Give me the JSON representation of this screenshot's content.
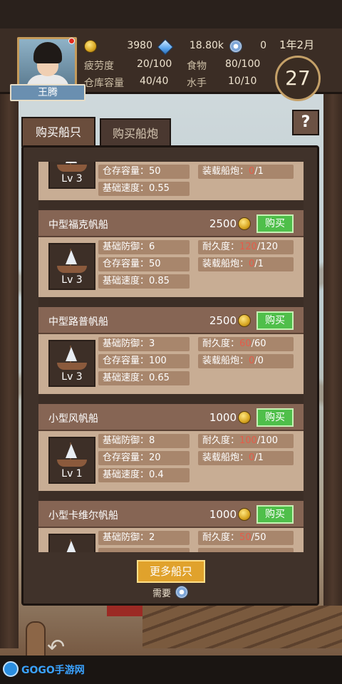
{
  "player": {
    "name": "王腾",
    "level": "27",
    "date": "1年2月"
  },
  "resources": {
    "gold": "3980",
    "gems": "18.80k",
    "medals": "0"
  },
  "stats": [
    {
      "label": "疲劳度",
      "value": "20/100"
    },
    {
      "label": "食物",
      "value": "80/100"
    },
    {
      "label": "仓库容量",
      "value": "40/40"
    },
    {
      "label": "水手",
      "value": "10/10"
    }
  ],
  "tabs": {
    "buy_ship": "购买船只",
    "buy_cannon": "购买船炮"
  },
  "help": "?",
  "partial_top": {
    "level": "Lv 3",
    "capacity": "仓存容量：50",
    "cannon_label": "装载船炮：",
    "cannon_cur": "0",
    "cannon_max": "/1",
    "speed": "基础速度：0.55"
  },
  "ships": [
    {
      "name": "中型福克帆船",
      "price": "2500",
      "buy": "购买",
      "level": "Lv 3",
      "defense": "基础防御：6",
      "dur_label": "耐久度：",
      "dur_cur": "120",
      "dur_max": "/120",
      "capacity": "仓存容量：50",
      "cannon_label": "装载船炮：",
      "cannon_cur": "0",
      "cannon_max": "/1",
      "speed": "基础速度：0.85"
    },
    {
      "name": "中型路普帆船",
      "price": "2500",
      "buy": "购买",
      "level": "Lv 3",
      "defense": "基础防御：3",
      "dur_label": "耐久度：",
      "dur_cur": "60",
      "dur_max": "/60",
      "capacity": "仓存容量：100",
      "cannon_label": "装载船炮：",
      "cannon_cur": "0",
      "cannon_max": "/0",
      "speed": "基础速度：0.65"
    },
    {
      "name": "小型风帆船",
      "price": "1000",
      "buy": "购买",
      "level": "Lv 1",
      "defense": "基础防御：8",
      "dur_label": "耐久度：",
      "dur_cur": "100",
      "dur_max": "/100",
      "capacity": "仓存容量：20",
      "cannon_label": "装载船炮：",
      "cannon_cur": "0",
      "cannon_max": "/1",
      "speed": "基础速度：0.4"
    },
    {
      "name": "小型卡维尔帆船",
      "price": "1000",
      "buy": "购买",
      "level": "",
      "defense": "基础防御：2",
      "dur_label": "耐久度：",
      "dur_cur": "50",
      "dur_max": "/50",
      "capacity": "",
      "cannon_label": "",
      "cannon_cur": "",
      "cannon_max": "",
      "speed": ""
    }
  ],
  "more_ships": "更多船只",
  "need": "需要",
  "watermark": "GOGO手游网"
}
